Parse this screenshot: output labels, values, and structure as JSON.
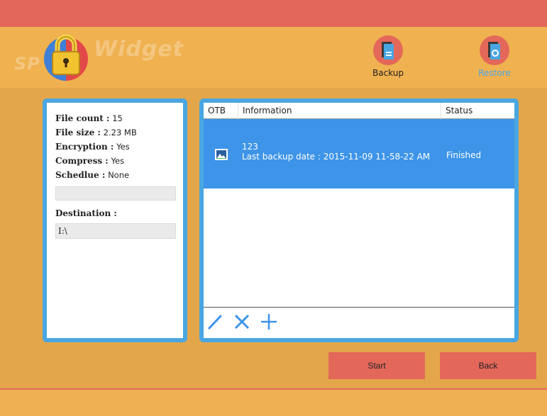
{
  "logo": {
    "text_left": "SP",
    "text_right": "Widget"
  },
  "header": {
    "backup_label": "Backup",
    "restore_label": "Restore"
  },
  "summary": {
    "file_count_label": "File count :",
    "file_count_value": "15",
    "file_size_label": "File size :",
    "file_size_value": "2.23 MB",
    "encryption_label": "Encryption :",
    "encryption_value": "Yes",
    "compress_label": "Compress :",
    "compress_value": "Yes",
    "schedule_label": "Schedlue :",
    "schedule_value": "None",
    "destination_label": "Destination :",
    "destination_value": "I:\\"
  },
  "table": {
    "columns": [
      "OTB",
      "Information",
      "Status"
    ],
    "rows": [
      {
        "name": "123",
        "detail": "Last backup date : 2015-11-09 11-58-22 AM",
        "status": "Finished"
      }
    ]
  },
  "actions": {
    "start_label": "Start",
    "back_label": "Back"
  },
  "colors": {
    "title_bar": "#e4685a",
    "header_bg": "#f0b150",
    "content_bg": "#e4a64a",
    "panel_border": "#4aa6e0",
    "selected_row": "#3d94e8",
    "restore_accent": "#4aa6e8"
  },
  "icons": {
    "backup": "backup-document-icon",
    "restore": "restore-document-icon",
    "row": "image-file-icon",
    "edit": "pencil-icon",
    "delete": "close-x-icon",
    "add": "plus-icon"
  }
}
